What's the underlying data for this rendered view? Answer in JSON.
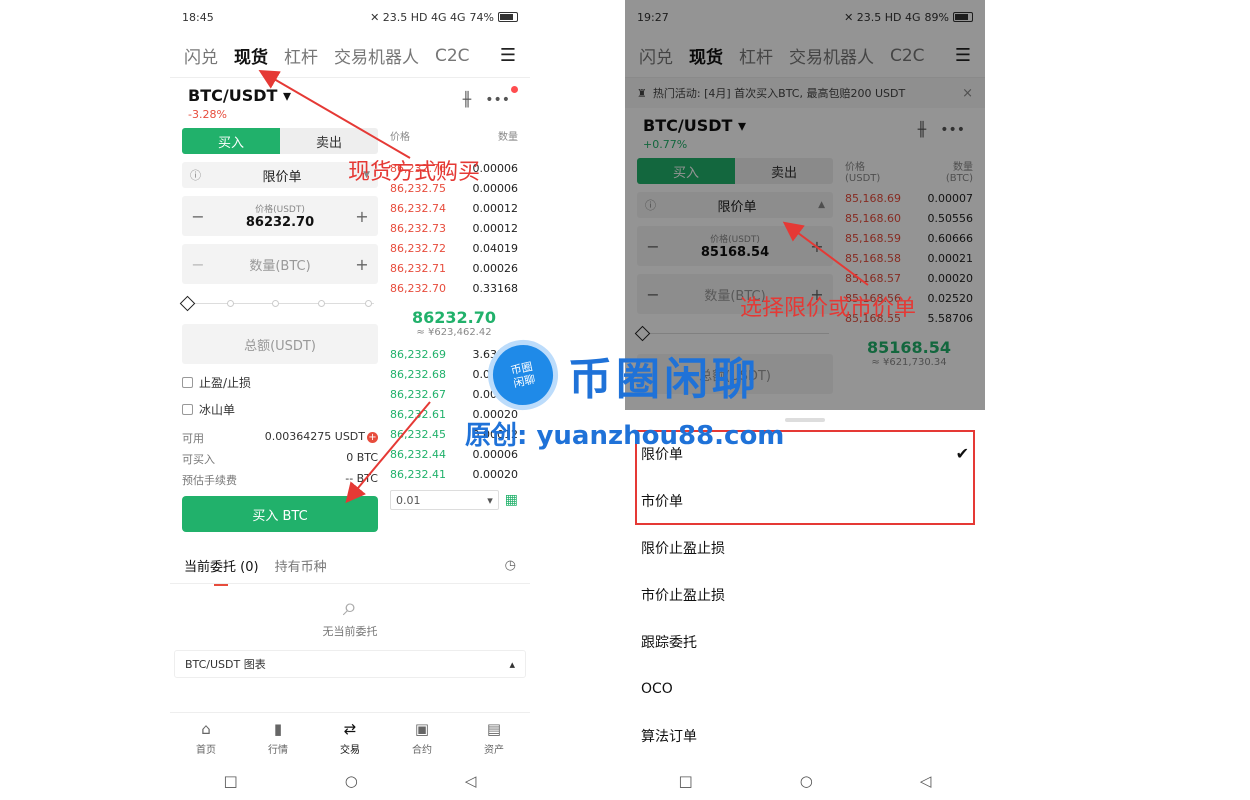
{
  "left": {
    "status": {
      "time": "18:45",
      "icons": "✕ 23.5 HD 4G 4G",
      "battery": "74%"
    },
    "tabs": [
      "闪兑",
      "现货",
      "杠杆",
      "交易机器人",
      "C2C"
    ],
    "active_tab": "现货",
    "pair": "BTC/USDT",
    "change": "-3.28%",
    "buy_label": "买入",
    "sell_label": "卖出",
    "order_type": "限价单",
    "price_label": "价格(USDT)",
    "price_value": "86232.70",
    "qty_placeholder": "数量(BTC)",
    "total_placeholder": "总额(USDT)",
    "tp_sl": "止盈/止损",
    "iceberg": "冰山单",
    "available_label": "可用",
    "available_value": "0.00364275 USDT",
    "can_buy_label": "可买入",
    "can_buy_value": "0 BTC",
    "fee_label": "预估手续费",
    "fee_value": "-- BTC",
    "buy_button": "买入 BTC",
    "ob_price_label": "价格",
    "ob_qty_label": "数量",
    "asks": [
      {
        "p": "86,232.76",
        "q": "0.00006"
      },
      {
        "p": "86,232.75",
        "q": "0.00006"
      },
      {
        "p": "86,232.74",
        "q": "0.00012"
      },
      {
        "p": "86,232.73",
        "q": "0.00012"
      },
      {
        "p": "86,232.72",
        "q": "0.04019"
      },
      {
        "p": "86,232.71",
        "q": "0.00026"
      },
      {
        "p": "86,232.70",
        "q": "0.33168"
      }
    ],
    "mid_price": "86232.70",
    "mid_cny": "≈ ¥623,462.42",
    "bids": [
      {
        "p": "86,232.69",
        "q": "3.63373"
      },
      {
        "p": "86,232.68",
        "q": "0.00017"
      },
      {
        "p": "86,232.67",
        "q": "0.00012"
      },
      {
        "p": "86,232.61",
        "q": "0.00020"
      },
      {
        "p": "86,232.45",
        "q": "0.00012"
      },
      {
        "p": "86,232.44",
        "q": "0.00006"
      },
      {
        "p": "86,232.41",
        "q": "0.00020"
      }
    ],
    "depth": "0.01",
    "orders_tab": "当前委托 (0)",
    "holdings_tab": "持有币种",
    "empty_text": "无当前委托",
    "chart_bar": "BTC/USDT 图表",
    "nav": [
      "首页",
      "行情",
      "交易",
      "合约",
      "资产"
    ]
  },
  "right": {
    "status": {
      "time": "19:27",
      "icons": "✕ 23.5 HD 4G",
      "battery": "89%"
    },
    "tabs": [
      "闪兑",
      "现货",
      "杠杆",
      "交易机器人",
      "C2C"
    ],
    "banner": "热门活动: [4月] 首次买入BTC, 最高包赔200 USDT",
    "pair": "BTC/USDT",
    "change": "+0.77%",
    "buy_label": "买入",
    "sell_label": "卖出",
    "order_type": "限价单",
    "price_label": "价格(USDT)",
    "price_value": "85168.54",
    "qty_placeholder": "数量(BTC)",
    "total_placeholder": "总额(USDT)",
    "ob_price_label": "价格",
    "ob_price_unit": "(USDT)",
    "ob_qty_label": "数量",
    "ob_qty_unit": "(BTC)",
    "asks": [
      {
        "p": "85,168.69",
        "q": "0.00007"
      },
      {
        "p": "85,168.60",
        "q": "0.50556"
      },
      {
        "p": "85,168.59",
        "q": "0.60666"
      },
      {
        "p": "85,168.58",
        "q": "0.00021"
      },
      {
        "p": "85,168.57",
        "q": "0.00020"
      },
      {
        "p": "85,168.56",
        "q": "0.02520"
      },
      {
        "p": "85,168.55",
        "q": "5.58706"
      }
    ],
    "mid_price": "85168.54",
    "mid_cny": "≈ ¥621,730.34",
    "sheet_items": [
      "限价单",
      "市价单",
      "限价止盈止损",
      "市价止盈止损",
      "跟踪委托",
      "OCO",
      "算法订单"
    ]
  },
  "annotations": {
    "spot_buy": "现货方式购买",
    "choose_type": "选择限价或市价单"
  },
  "watermark": {
    "logo_text": "币圈\n闲聊",
    "title": "币圈闲聊",
    "subtitle": "原创: yuanzhou88.com"
  },
  "colors": {
    "green": "#21b16b",
    "red": "#e74c3c",
    "annotation": "#e53935",
    "watermark": "#1f72d8"
  }
}
